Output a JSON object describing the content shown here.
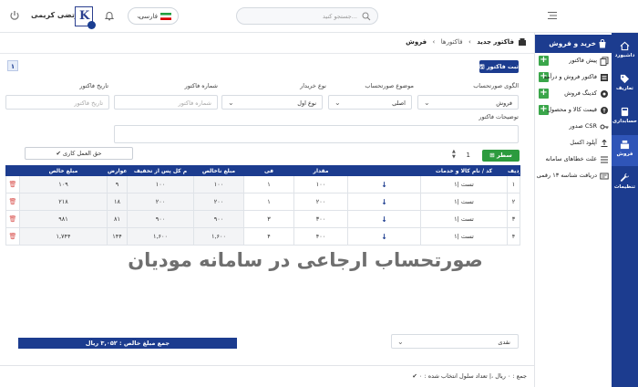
{
  "topbar": {
    "user_name": "مرتضی کریمی",
    "logo_letter": "K",
    "language": "فارسی",
    "search_placeholder": "جستجو کنید...",
    "icons": [
      "power-icon",
      "bell-icon",
      "flag-iran-icon",
      "chevron-down-icon",
      "search-icon",
      "menu-icon"
    ]
  },
  "sidebar": {
    "items": [
      {
        "label": "داشبورد",
        "icon": "home-icon"
      },
      {
        "label": "تعاریف",
        "icon": "tag-icon"
      },
      {
        "label": "حسابداری",
        "icon": "calculator-icon"
      },
      {
        "label": "فروش",
        "icon": "cash-register-icon"
      },
      {
        "label": "تنظیمات",
        "icon": "wrench-icon"
      }
    ],
    "active_index": 3
  },
  "submenu": {
    "title": "خرید و فروش",
    "items": [
      {
        "label": "پیش فاکتور",
        "plus": true
      },
      {
        "label": "فاکتور فروش و درآمد",
        "plus": true
      },
      {
        "label": "کدینگ فروش",
        "plus": true
      },
      {
        "label": "قیمت کالا و محصول",
        "plus": true
      },
      {
        "label": "صدور CSR",
        "plus": false
      },
      {
        "label": "آپلود اکسل",
        "plus": false
      },
      {
        "label": "علت خطاهای سامانه",
        "plus": false
      },
      {
        "label": "دریافت شناسه ۱۳ رقمی",
        "plus": false
      }
    ]
  },
  "breadcrumb": {
    "root": "فروش",
    "middle": "فاکتورها",
    "current": "فاکتور جدید",
    "separator": "›"
  },
  "form": {
    "submit_label": "ثبت فاکتور",
    "tab_number": "۱",
    "fields": {
      "pattern_label": "الگوی صورتحساب",
      "pattern_value": "فروش",
      "subject_label": "موضوع صورتحساب",
      "subject_value": "اصلی",
      "buyer_type_label": "نوع خریدار",
      "buyer_type_value": "نوع اول",
      "invoice_no_label": "شماره فاکتور",
      "invoice_no_placeholder": "شماره فاکتور",
      "invoice_date_label": "تاریخ فاکتور",
      "invoice_date_placeholder": "تاریخ فاکتور",
      "description_label": "توضیحات فاکتور"
    },
    "new_row_label": "سطر جدید",
    "stepper_value": "1",
    "vat_button_label": "✔ حق العمل کاری"
  },
  "table": {
    "headers": [
      "ردیف",
      "کد / نام کالا و خدمات",
      "",
      "مقدار",
      "فی",
      "مبلغ ناخالص",
      "م کل پس از تخفیف",
      "مبلغ مالیات و عوارض",
      "مبلغ خالص",
      ""
    ],
    "rows": [
      {
        "idx": "۱",
        "item": "۱| تست",
        "qty": "۱۰۰",
        "fee": "۱",
        "gross": "۱۰۰",
        "after_discount": "۱۰۰",
        "tax": "۹",
        "net": "۱۰۹"
      },
      {
        "idx": "۲",
        "item": "۱| تست",
        "qty": "۲۰۰",
        "fee": "۱",
        "gross": "۲۰۰",
        "after_discount": "۲۰۰",
        "tax": "۱۸",
        "net": "۲۱۸"
      },
      {
        "idx": "۳",
        "item": "۱| تست",
        "qty": "۳۰۰",
        "fee": "۳",
        "gross": "۹۰۰",
        "after_discount": "۹۰۰",
        "tax": "۸۱",
        "net": "۹۸۱"
      },
      {
        "idx": "۴",
        "item": "۱| تست",
        "qty": "۴۰۰",
        "fee": "۴",
        "gross": "۱,۶۰۰",
        "after_discount": "۱,۶۰۰",
        "tax": "۱۴۴",
        "net": "۱,۷۴۴"
      }
    ]
  },
  "watermark": "صورتحساب ارجاعی در سامانه مودیان",
  "totals": {
    "net_total": "جمع مبلغ خالص : ۳,۰۵۲ ریال",
    "payment_method": "نقدی"
  },
  "footer": {
    "summary": "جمع : ۰ ریال ،| تعداد سلول انتخاب شده : ۰"
  },
  "colors": {
    "primary": "#1c3c8f",
    "success": "#2c9b3e",
    "danger": "#d9534f"
  }
}
